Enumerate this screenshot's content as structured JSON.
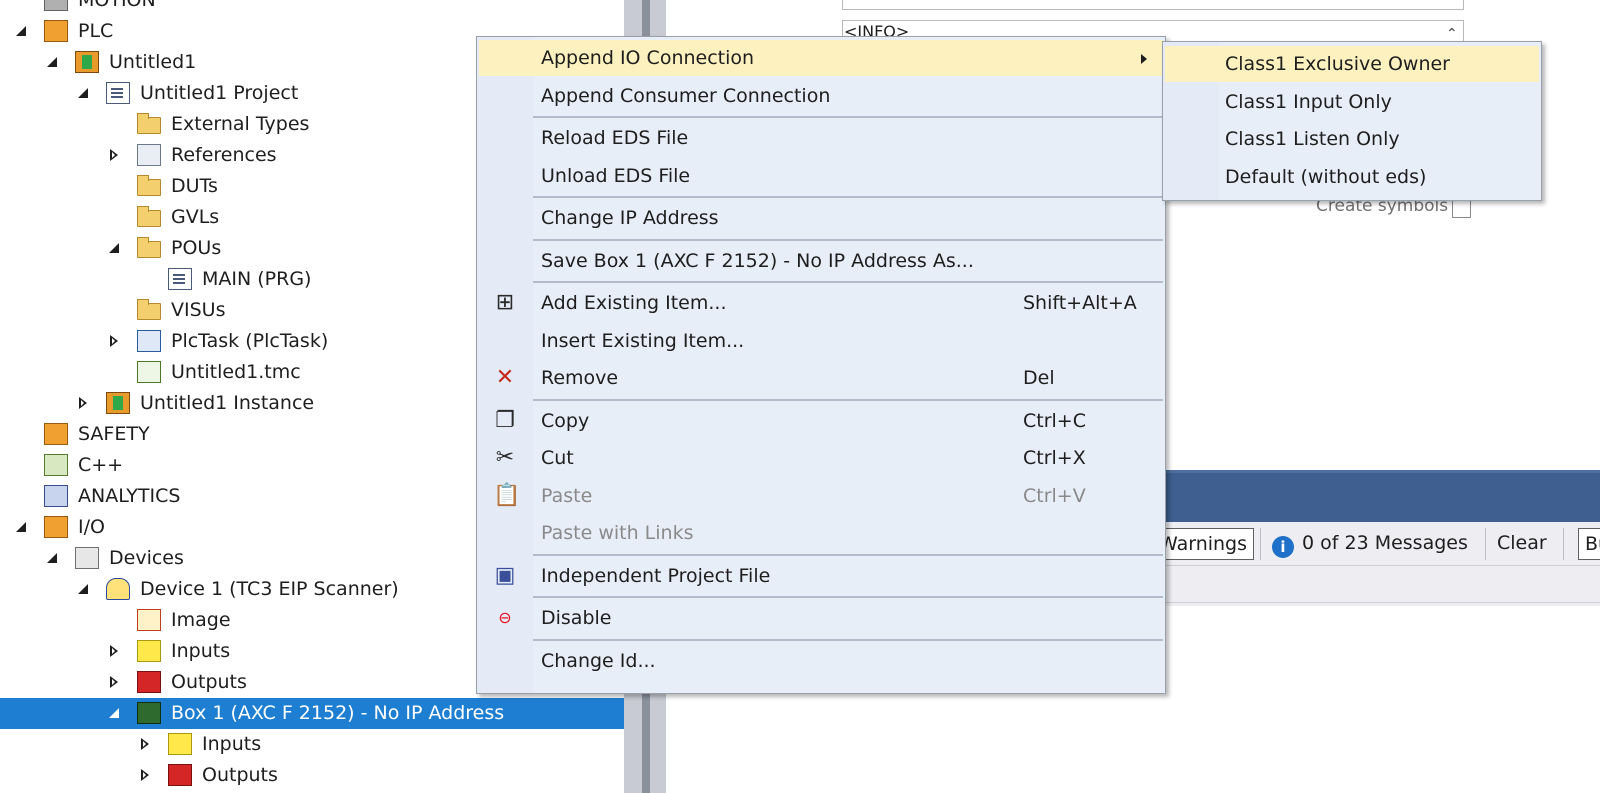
{
  "tree": {
    "items": [
      {
        "label": "MOTION",
        "depth": 0,
        "expander": "none",
        "icon": "motion-icon"
      },
      {
        "label": "PLC",
        "depth": 0,
        "expander": "open",
        "icon": "plc-icon"
      },
      {
        "label": "Untitled1",
        "depth": 1,
        "expander": "open",
        "icon": "plc-project-icon"
      },
      {
        "label": "Untitled1 Project",
        "depth": 2,
        "expander": "open",
        "icon": "project-icon"
      },
      {
        "label": "External Types",
        "depth": 3,
        "expander": "none",
        "icon": "folder-icon"
      },
      {
        "label": "References",
        "depth": 3,
        "expander": "closed",
        "icon": "references-icon"
      },
      {
        "label": "DUTs",
        "depth": 3,
        "expander": "none",
        "icon": "folder-icon"
      },
      {
        "label": "GVLs",
        "depth": 3,
        "expander": "none",
        "icon": "folder-icon"
      },
      {
        "label": "POUs",
        "depth": 3,
        "expander": "open",
        "icon": "folder-open-icon"
      },
      {
        "label": "MAIN (PRG)",
        "depth": 4,
        "expander": "none",
        "icon": "program-icon"
      },
      {
        "label": "VISUs",
        "depth": 3,
        "expander": "none",
        "icon": "folder-icon"
      },
      {
        "label": "PlcTask (PlcTask)",
        "depth": 3,
        "expander": "closed",
        "icon": "task-icon"
      },
      {
        "label": "Untitled1.tmc",
        "depth": 3,
        "expander": "none",
        "icon": "tmc-icon"
      },
      {
        "label": "Untitled1 Instance",
        "depth": 2,
        "expander": "closed",
        "icon": "instance-icon"
      },
      {
        "label": "SAFETY",
        "depth": 0,
        "expander": "none",
        "icon": "safety-icon"
      },
      {
        "label": "C++",
        "depth": 0,
        "expander": "none",
        "icon": "cpp-icon"
      },
      {
        "label": "ANALYTICS",
        "depth": 0,
        "expander": "none",
        "icon": "analytics-icon"
      },
      {
        "label": "I/O",
        "depth": 0,
        "expander": "open",
        "icon": "io-icon"
      },
      {
        "label": "Devices",
        "depth": 1,
        "expander": "open",
        "icon": "devices-icon"
      },
      {
        "label": "Device 1 (TC3 EIP Scanner)",
        "depth": 2,
        "expander": "open",
        "icon": "scanner-icon"
      },
      {
        "label": "Image",
        "depth": 3,
        "expander": "none",
        "icon": "image-icon"
      },
      {
        "label": "Inputs",
        "depth": 3,
        "expander": "closed",
        "icon": "inputs-icon"
      },
      {
        "label": "Outputs",
        "depth": 3,
        "expander": "closed",
        "icon": "outputs-icon"
      },
      {
        "label": "Box 1 (AXC F 2152) - No IP Address",
        "depth": 3,
        "expander": "open",
        "icon": "box-icon",
        "selected": true
      },
      {
        "label": "Inputs",
        "depth": 4,
        "expander": "closed",
        "icon": "inputs-icon"
      },
      {
        "label": "Outputs",
        "depth": 4,
        "expander": "closed",
        "icon": "outputs-icon"
      }
    ]
  },
  "properties": {
    "combo_value": "<INFO>",
    "create_symbols_label": "Create symbols"
  },
  "error_list": {
    "warnings_label": "Warnings",
    "messages_label": "0 of 23 Messages",
    "clear_label": "Clear",
    "build_label": "Bu"
  },
  "context_menu": {
    "items": [
      {
        "type": "item",
        "label": "Append IO Connection",
        "submenu": true,
        "highlighted": true
      },
      {
        "type": "item",
        "label": "Append Consumer Connection"
      },
      {
        "type": "sep"
      },
      {
        "type": "item",
        "label": "Reload EDS File"
      },
      {
        "type": "item",
        "label": "Unload EDS File"
      },
      {
        "type": "sep"
      },
      {
        "type": "item",
        "label": "Change IP Address"
      },
      {
        "type": "sep"
      },
      {
        "type": "item",
        "label": "Save Box 1 (AXC F 2152) - No IP Address As..."
      },
      {
        "type": "sep"
      },
      {
        "type": "item",
        "label": "Add Existing Item...",
        "shortcut": "Shift+Alt+A",
        "icon": "add-existing-icon"
      },
      {
        "type": "item",
        "label": "Insert Existing Item..."
      },
      {
        "type": "item",
        "label": "Remove",
        "shortcut": "Del",
        "icon": "remove-icon"
      },
      {
        "type": "sep"
      },
      {
        "type": "item",
        "label": "Copy",
        "shortcut": "Ctrl+C",
        "icon": "copy-icon"
      },
      {
        "type": "item",
        "label": "Cut",
        "shortcut": "Ctrl+X",
        "icon": "cut-icon"
      },
      {
        "type": "item",
        "label": "Paste",
        "shortcut": "Ctrl+V",
        "icon": "paste-icon",
        "disabled": true
      },
      {
        "type": "item",
        "label": "Paste with Links",
        "disabled": true
      },
      {
        "type": "sep"
      },
      {
        "type": "item",
        "label": "Independent Project File",
        "icon": "save-icon"
      },
      {
        "type": "sep"
      },
      {
        "type": "item",
        "label": "Disable",
        "icon": "disable-icon"
      },
      {
        "type": "sep"
      },
      {
        "type": "item",
        "label": "Change Id..."
      }
    ]
  },
  "submenu": {
    "items": [
      {
        "label": "Class1 Exclusive Owner",
        "highlighted": true
      },
      {
        "label": "Class1 Input Only"
      },
      {
        "label": "Class1 Listen Only"
      },
      {
        "label": "Default (without eds)"
      }
    ]
  },
  "colors": {
    "selection": "#1e7fd2",
    "menu_background": "#e8eef8",
    "menu_highlight": "#fdf2bf",
    "remove_icon": "#c42b1c",
    "disable_icon": "#e81123"
  }
}
